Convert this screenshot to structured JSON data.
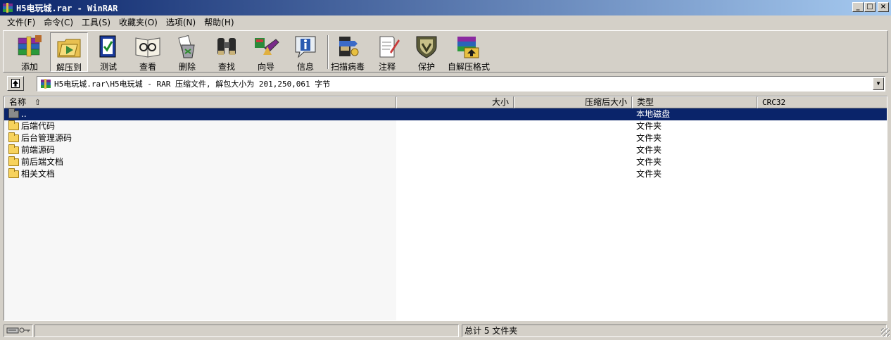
{
  "window": {
    "title": "H5电玩城.rar - WinRAR",
    "buttons": [
      "_",
      "□",
      "×"
    ]
  },
  "menu": [
    {
      "label": "文件(F)"
    },
    {
      "label": "命令(C)"
    },
    {
      "label": "工具(S)"
    },
    {
      "label": "收藏夹(O)"
    },
    {
      "label": "选项(N)"
    },
    {
      "label": "帮助(H)"
    }
  ],
  "toolbar": [
    {
      "label": "添加",
      "icon": "add-books-icon"
    },
    {
      "label": "解压到",
      "icon": "extract-folder-icon",
      "pressed": true
    },
    {
      "label": "测试",
      "icon": "test-book-icon"
    },
    {
      "label": "查看",
      "icon": "view-glasses-icon"
    },
    {
      "label": "删除",
      "icon": "delete-recycle-icon"
    },
    {
      "label": "查找",
      "icon": "find-binoculars-icon"
    },
    {
      "label": "向导",
      "icon": "wizard-icon"
    },
    {
      "label": "信息",
      "icon": "info-icon"
    },
    {
      "label": "扫描病毒",
      "icon": "virus-scan-icon"
    },
    {
      "label": "注释",
      "icon": "comment-icon"
    },
    {
      "label": "保护",
      "icon": "protect-shield-icon"
    },
    {
      "label": "自解压格式",
      "icon": "sfx-box-icon"
    }
  ],
  "address": {
    "text": "H5电玩城.rar\\H5电玩城 - RAR 压缩文件, 解包大小为 201,250,061 字节"
  },
  "columns": {
    "name": "名称",
    "size": "大小",
    "packed": "压缩后大小",
    "type": "类型",
    "crc": "CRC32"
  },
  "rows": [
    {
      "name": "..",
      "type": "本地磁盘",
      "selected": true
    },
    {
      "name": "后端代码",
      "type": "文件夹"
    },
    {
      "name": "后台管理源码",
      "type": "文件夹"
    },
    {
      "name": "前端源码",
      "type": "文件夹"
    },
    {
      "name": "前后端文档",
      "type": "文件夹"
    },
    {
      "name": "相关文档",
      "type": "文件夹"
    }
  ],
  "status": {
    "summary": "总计 5 文件夹"
  },
  "colors": {
    "titlebar": "#0a246a",
    "selection": "#0a246a",
    "face": "#d4d0c8"
  }
}
